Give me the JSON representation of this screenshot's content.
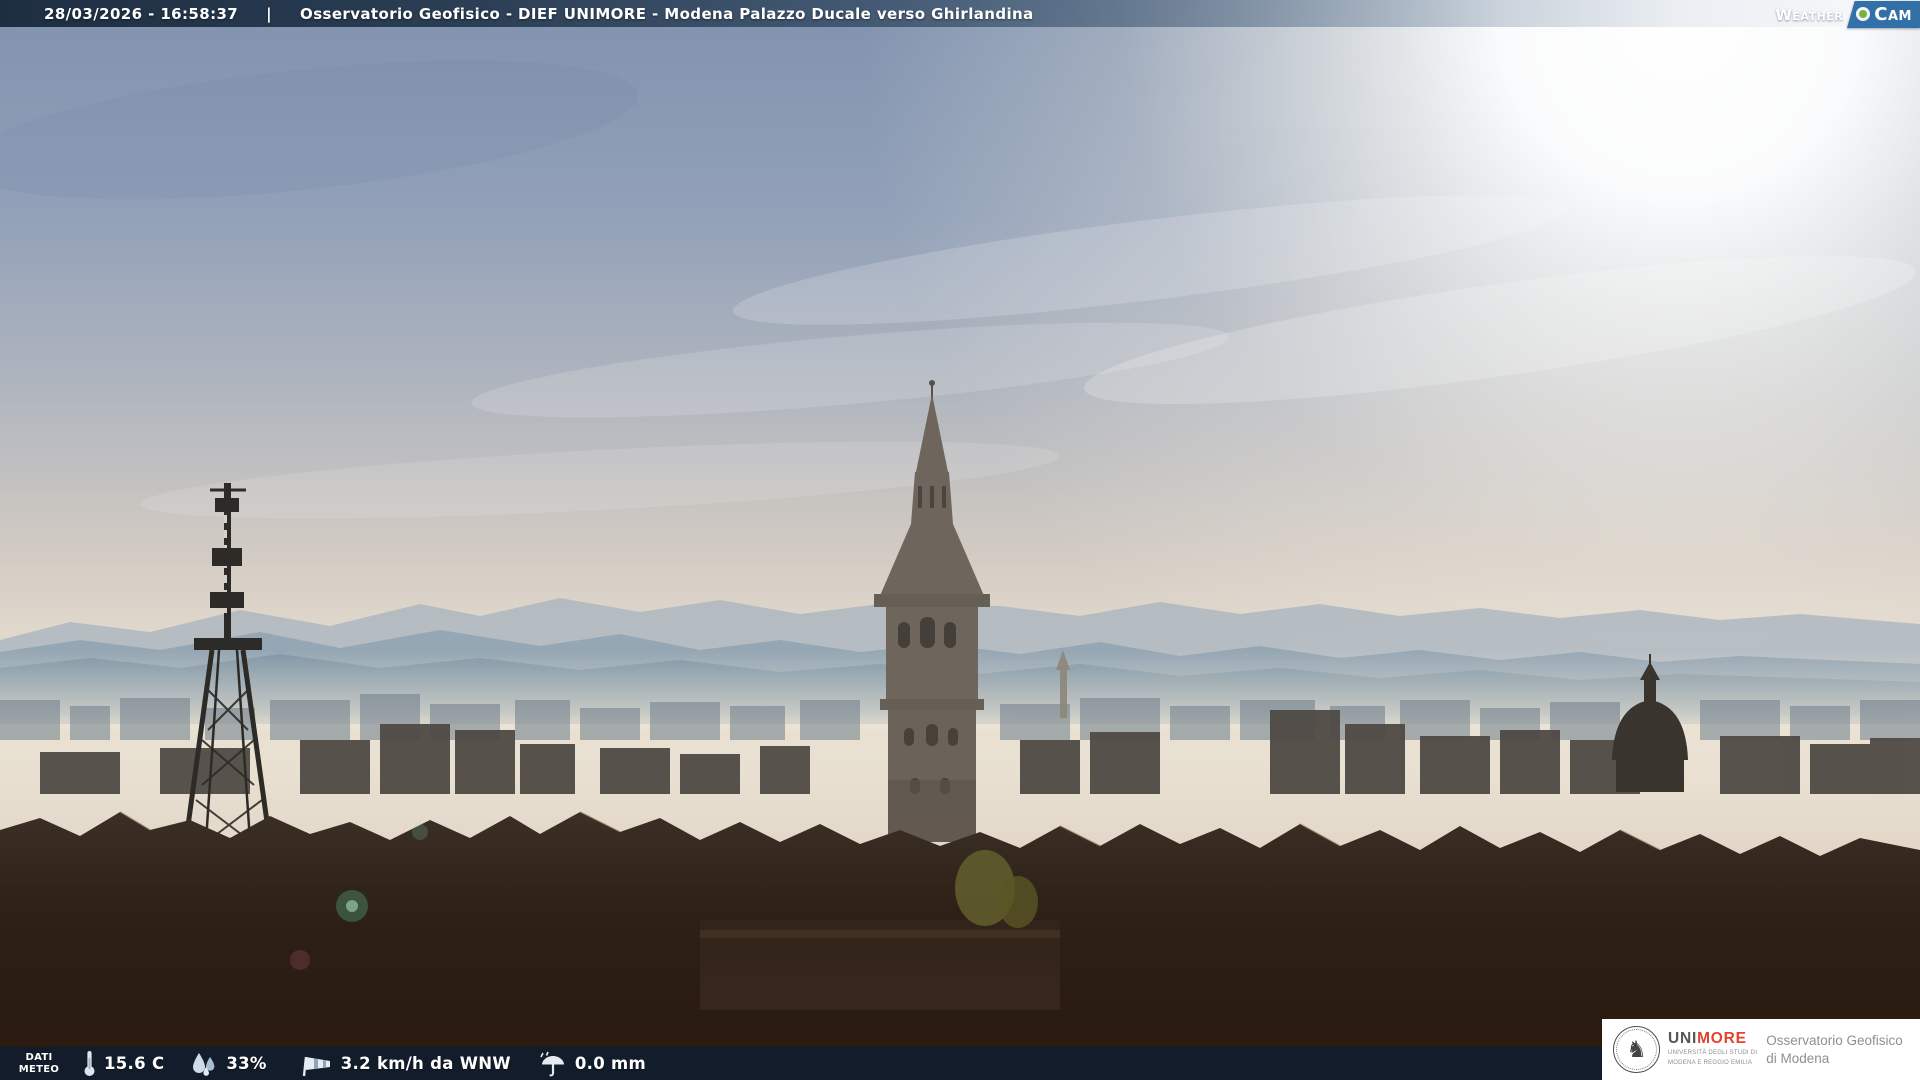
{
  "header": {
    "datetime": "28/03/2026 - 16:58:37",
    "separator": "|",
    "title": "Osservatorio Geofisico - DIEF UNIMORE - Modena Palazzo Ducale verso Ghirlandina"
  },
  "watermark": {
    "weather": "Weather",
    "cam": "Cam",
    "icon": "camera-lens-dot-icon",
    "plate_color": "#3470a8",
    "dot_color": "#79b23e"
  },
  "meteo": {
    "label": [
      "DATI",
      "METEO"
    ],
    "items": [
      {
        "icon": "thermometer-icon",
        "value": "15.6 C"
      },
      {
        "icon": "humidity-drops-icon",
        "value": "33%"
      },
      {
        "icon": "windsock-icon",
        "value": "3.2 km/h da WNW"
      },
      {
        "icon": "rain-umbrella-icon",
        "value": "0.0 mm"
      }
    ]
  },
  "branding": {
    "seal_glyph": "♞",
    "uni": "UNI",
    "more": "MORE",
    "sub1": "UNIVERSITÀ DEGLI STUDI DI",
    "sub2": "MODENA E REGGIO EMILIA",
    "obs1": "Osservatorio Geofisico",
    "obs2": "di Modena",
    "unimore_red": "#e6402e",
    "text_gray": "#8f8f93"
  },
  "scene": {
    "description": "Webcam view over Modena rooftops toward the Ghirlandina tower at sunset, sun glowing top right, hazy Apennine ridges on the horizon, telecom lattice tower at left, church dome at right",
    "colors": {
      "sky_top": "#7f92ae",
      "sky_horizon": "#e9e0d2",
      "sun_glow": "#ffffff",
      "mountains": "#7b92a2",
      "foreground_city": "#17110d",
      "bar_navy": "rgba(13,30,50,0.78)"
    }
  }
}
